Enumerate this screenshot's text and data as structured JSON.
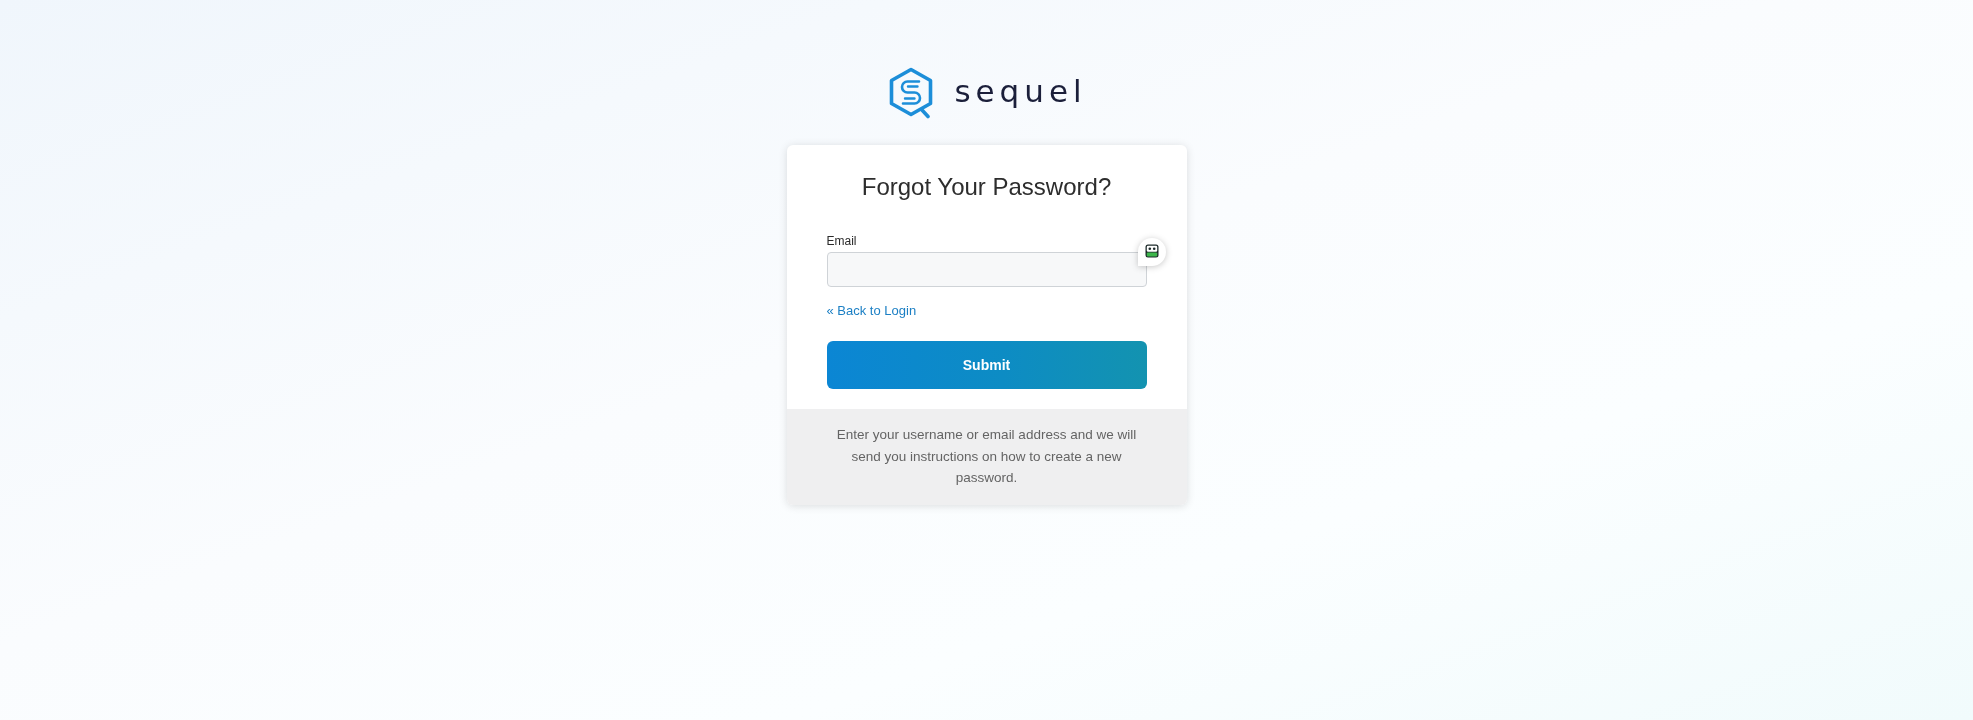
{
  "logo": {
    "text": "sequel"
  },
  "card": {
    "title": "Forgot Your Password?",
    "email_field": {
      "label": "Email"
    },
    "back_link": "« Back to Login",
    "submit_button": "Submit",
    "help_text": "Enter your username or email address and we will send you instructions on how to create a new password."
  }
}
